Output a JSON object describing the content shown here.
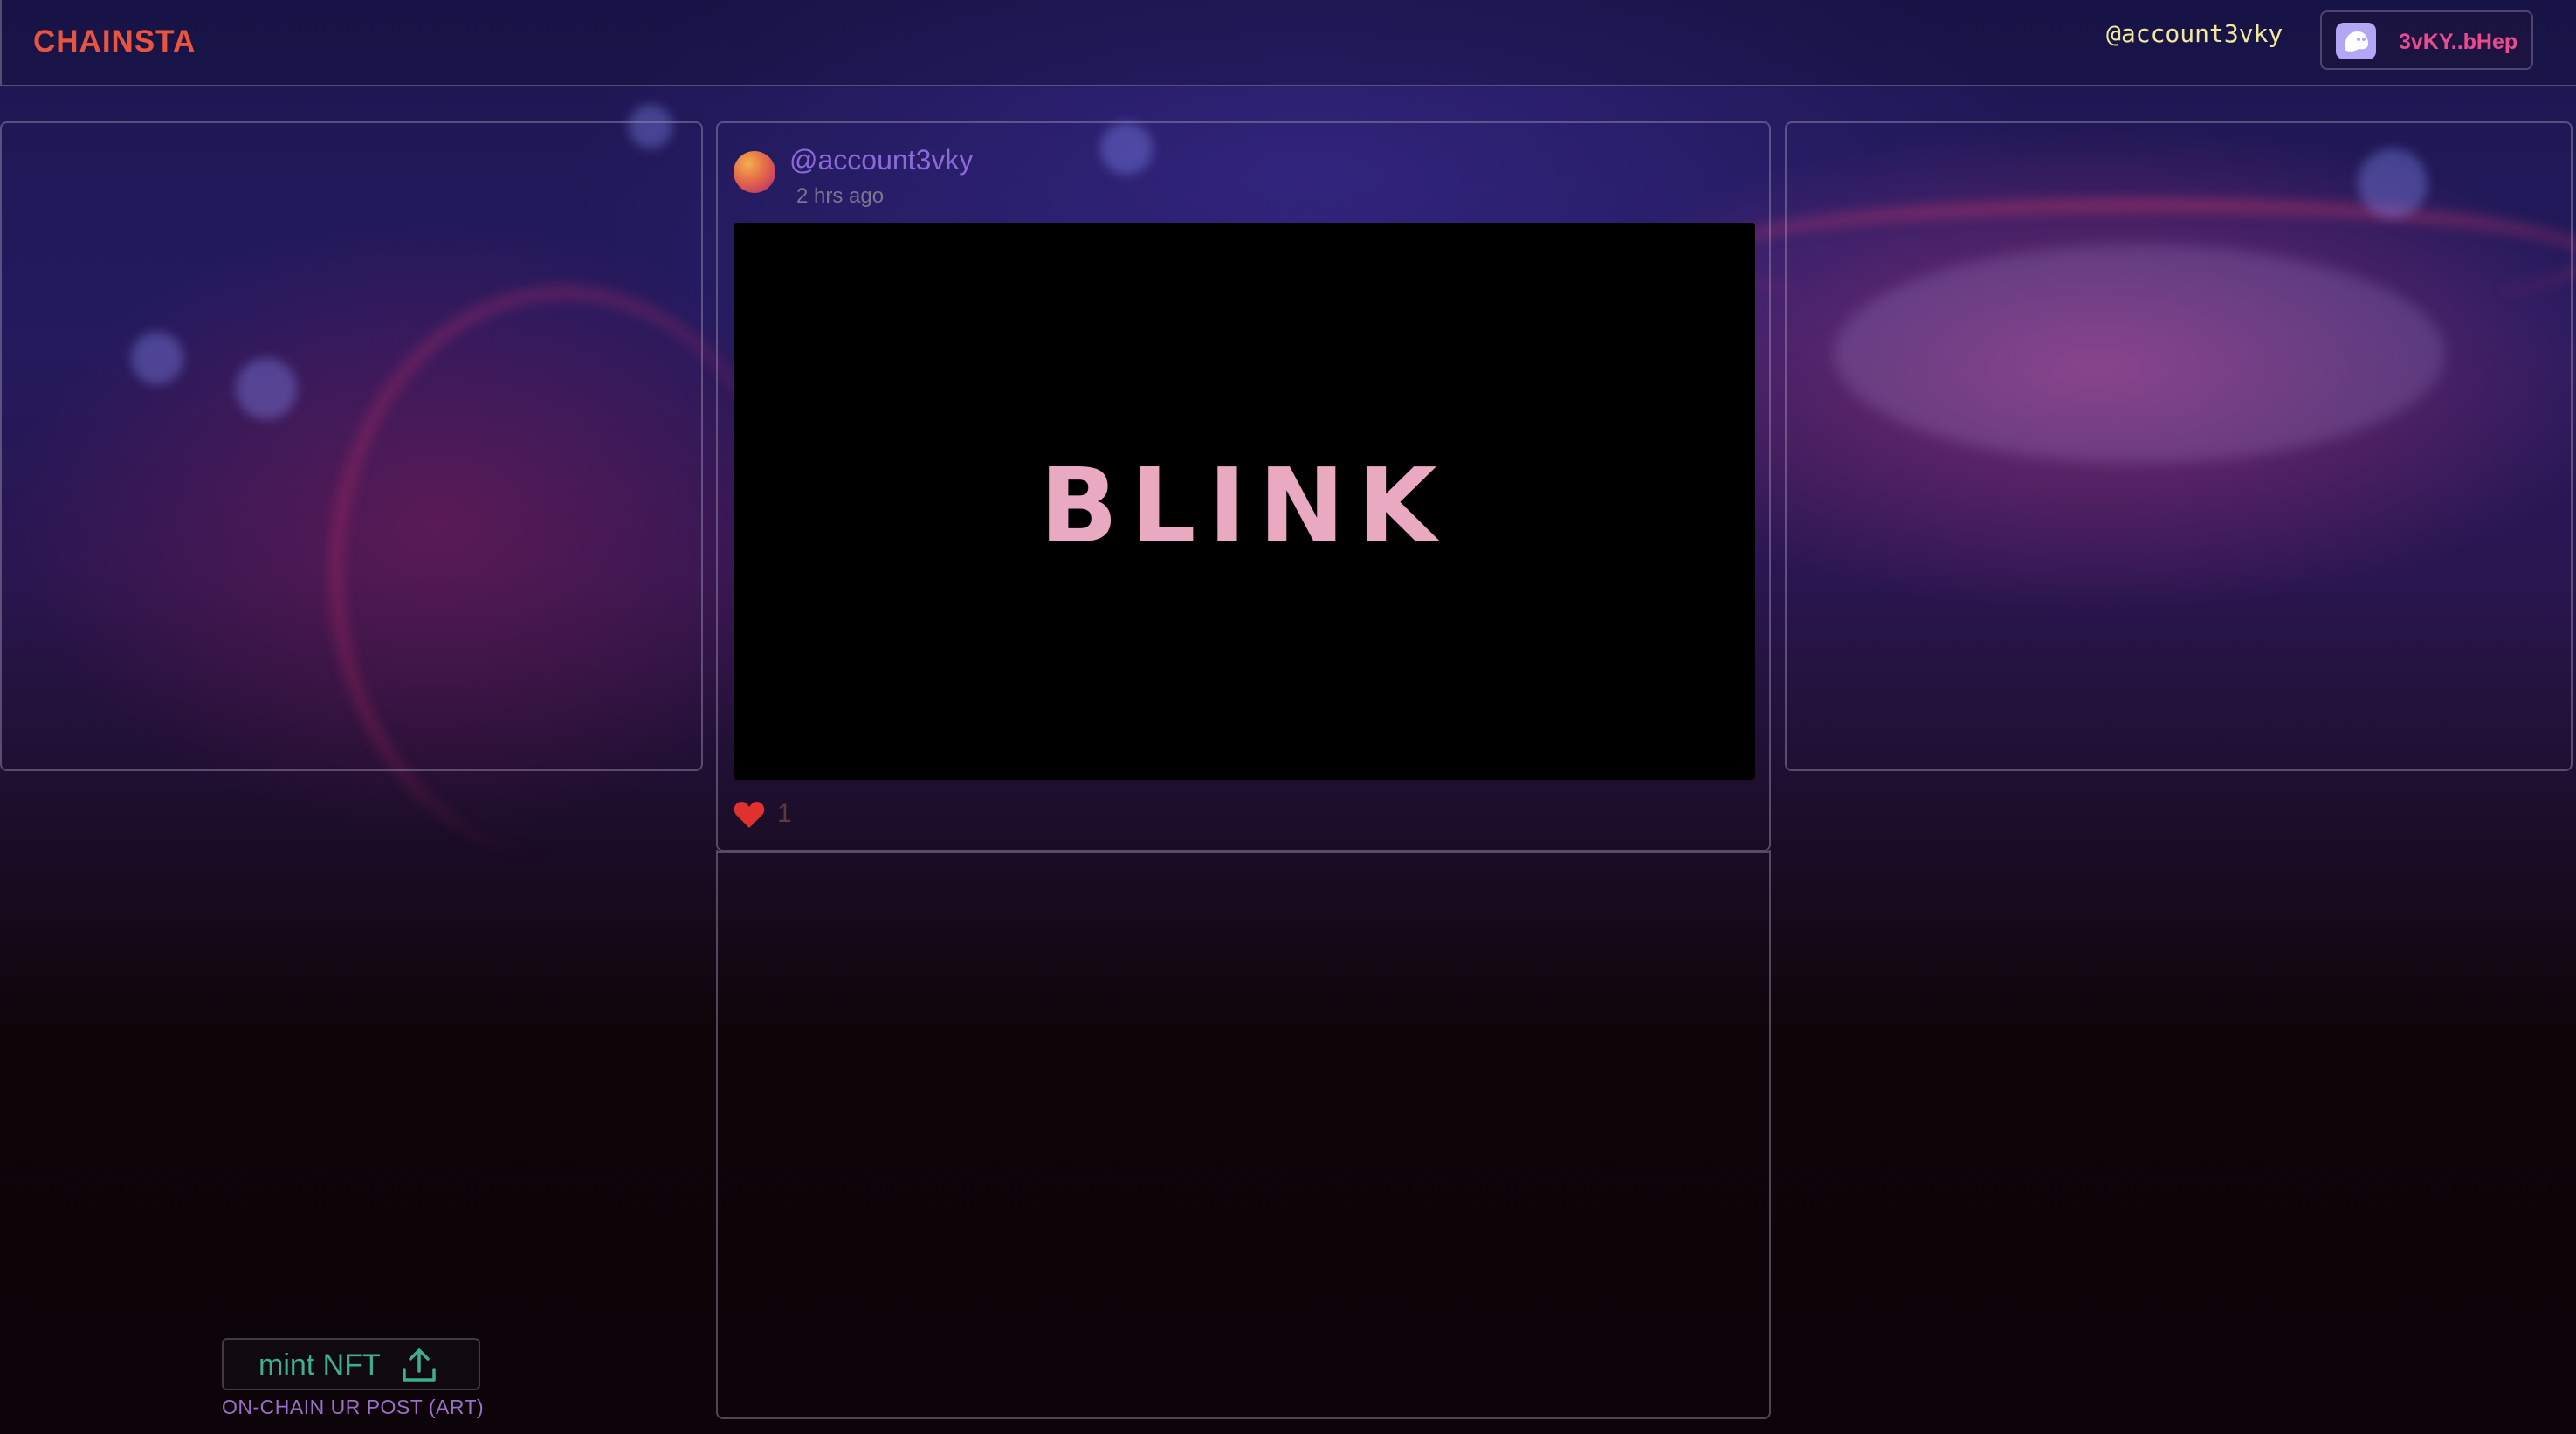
{
  "header": {
    "logo": "CHAINSTA",
    "handle": "@account3vky",
    "wallet_label": "3vKY..bHep"
  },
  "post": {
    "author": "@account3vky",
    "time": "2 hrs ago",
    "image_text": "BLINK",
    "likes": "1"
  },
  "mint": {
    "label": "mint NFT",
    "caption": "ON-CHAIN UR POST (ART)"
  },
  "colors": {
    "logo": "#e8553e",
    "handle": "#f1e89a",
    "wallet_label": "#e84c8f",
    "author": "#8b6ad8",
    "image_text": "#e8a9c1",
    "heart": "#e0312c",
    "mint_label": "#3fae8a",
    "caption": "#9b6fc6"
  },
  "icons": {
    "wallet": "ghost-icon",
    "like": "heart-icon",
    "mint": "upload-icon"
  }
}
